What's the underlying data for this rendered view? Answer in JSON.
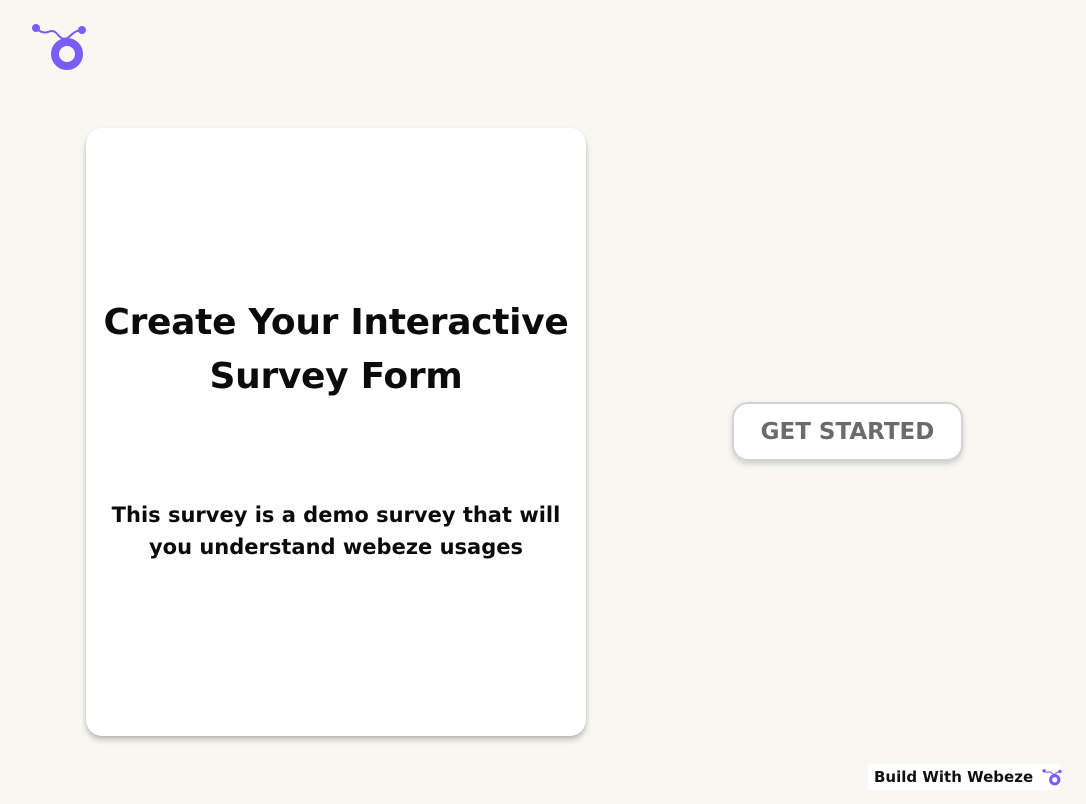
{
  "brand": {
    "logo_icon": "webeze-logo-icon",
    "accent_color": "#7b5cf6"
  },
  "intro_card": {
    "title": "Create Your Interactive Survey Form",
    "subtitle": "This survey is a demo survey that will you understand webeze usages"
  },
  "cta": {
    "label": "GET STARTED"
  },
  "footer_badge": {
    "label": "Build With Webeze",
    "icon": "webeze-logo-icon"
  }
}
